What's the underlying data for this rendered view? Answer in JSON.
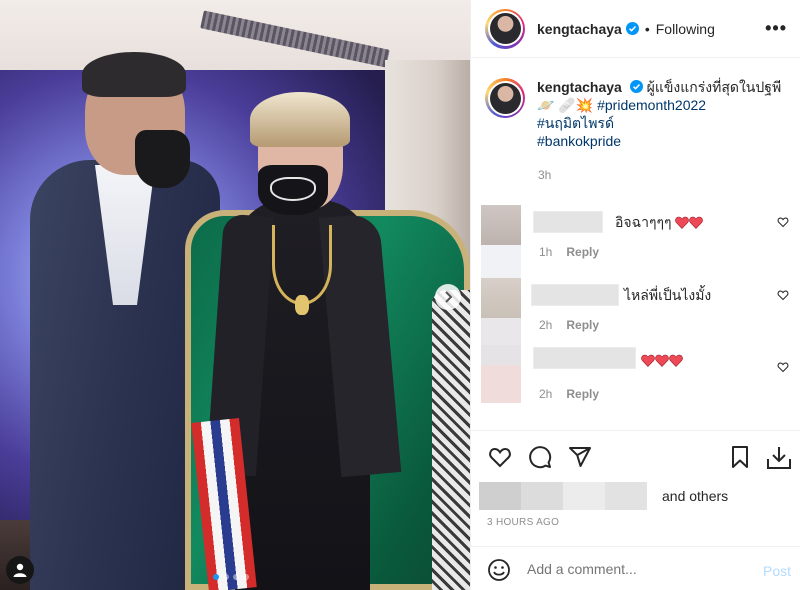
{
  "post": {
    "username": "kengtachaya",
    "follow_status": "Following",
    "separator": "•",
    "more_label": "•••",
    "caption": {
      "text": "ผู้แข็งแกร่งที่สุดในปฐพี",
      "emoji_1": "🪐",
      "emoji_2": "🩹",
      "emoji_3": "💥",
      "hashtags": [
        "#pridemonth2022",
        "#นฤมิตไพรด์",
        "#bankokpride"
      ]
    },
    "caption_time": "3h"
  },
  "comments": [
    {
      "text": "อิจฉาๆๆๆ",
      "hearts": 2,
      "time": "1h",
      "reply_label": "Reply"
    },
    {
      "text": "ไหล่พี่เป็นไงมั้ง",
      "hearts": 0,
      "time": "2h",
      "reply_label": "Reply"
    },
    {
      "text": "",
      "hearts": 3,
      "time": "2h",
      "reply_label": "Reply"
    }
  ],
  "likes": {
    "suffix": "and others"
  },
  "timestamp": "3 HOURS AGO",
  "add_comment": {
    "placeholder": "Add a comment...",
    "post_label": "Post"
  },
  "carousel": {
    "count": 4,
    "active": 0
  },
  "colors": {
    "link": "#00376b",
    "verified": "#0095f6",
    "heart": "#ed4956",
    "post_disabled": "#b3dbff",
    "dot_active": "#1a95f0"
  },
  "icons": [
    "verified-badge-icon",
    "heart-icon",
    "comment-icon",
    "share-icon",
    "bookmark-icon",
    "download-icon",
    "emoji-icon",
    "next-arrow-icon",
    "user-tag-icon"
  ]
}
